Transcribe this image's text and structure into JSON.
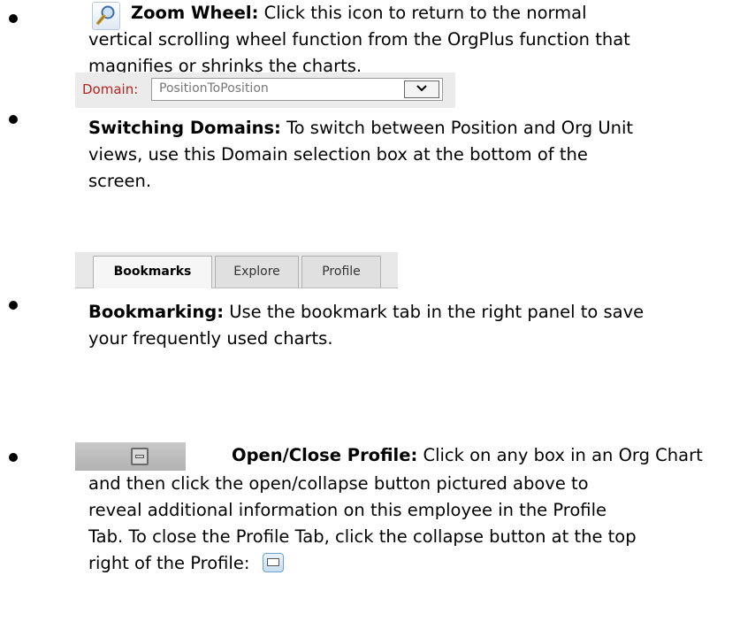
{
  "items": [
    {
      "title": "Zoom Wheel:",
      "body": "Click this icon to return to the normal",
      "body_lines": [
        "vertical scrolling wheel function from the OrgPlus function that",
        "magnifies or shrinks the charts."
      ],
      "icon": "zoom-magnifier-icon"
    },
    {
      "domain_label": "Domain:",
      "domain_value": "PositionToPosition",
      "arrow": "⌵",
      "title": "Switching Domains:",
      "body": "To switch between Position and Org Unit",
      "body_lines": [
        "views, use this Domain selection box at the bottom of the",
        "screen."
      ]
    },
    {
      "tabs": [
        "Bookmarks",
        "Explore",
        "Profile"
      ],
      "title": "Bookmarking:",
      "body": "Use the bookmark tab in the right panel to save",
      "body_lines": [
        "your frequently used charts."
      ]
    },
    {
      "title": "Open/Close Profile:",
      "body": "Click on any box in an Org Chart",
      "body_lines": [
        "and then click the open/collapse button pictured above to",
        "reveal additional information on this employee in the Profile",
        "Tab.  To close the Profile Tab, click the collapse button at the top",
        "right of the Profile:"
      ],
      "icon": "collapse-icon"
    }
  ]
}
